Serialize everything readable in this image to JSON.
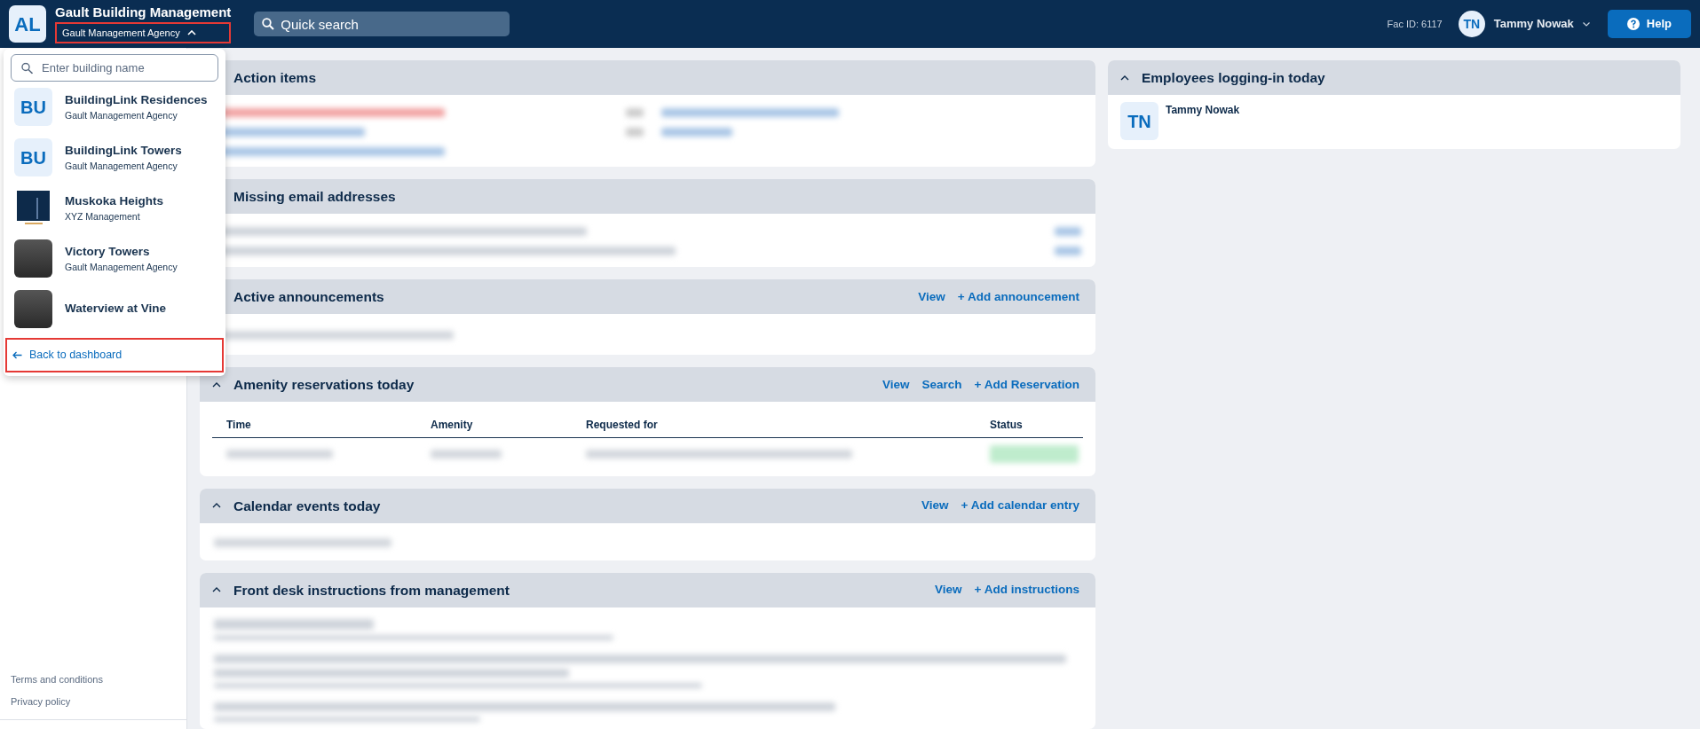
{
  "topbar": {
    "logo_initials": "AL",
    "company": "Gault Building Management",
    "agency_switcher": {
      "label": "Gault Management Agency",
      "expanded": true,
      "highlighted": true
    },
    "search": {
      "placeholder": "Quick search"
    },
    "fac_id": "Fac ID: 6117",
    "user": {
      "initials": "TN",
      "name": "Tammy Nowak"
    },
    "help": "Help"
  },
  "building_dropdown": {
    "search": {
      "placeholder": "Enter building name"
    },
    "buildings": [
      {
        "kind": "initials",
        "initials": "BU",
        "name": "BuildingLink Residences",
        "agency": "Gault Management Agency"
      },
      {
        "kind": "initials",
        "initials": "BU",
        "name": "BuildingLink Towers",
        "agency": "Gault Management Agency"
      },
      {
        "kind": "logo",
        "name": "Muskoka Heights",
        "agency": "XYZ Management"
      },
      {
        "kind": "photo",
        "name": "Victory Towers",
        "agency": "Gault Management Agency"
      },
      {
        "kind": "photo",
        "name": "Waterview at Vine"
      }
    ],
    "back_link": {
      "label": "Back to dashboard",
      "highlighted": true
    }
  },
  "sidebar_footer": [
    "Terms and conditions",
    "Privacy policy"
  ],
  "panels": [
    {
      "kind": "action_items",
      "title": "Action items"
    },
    {
      "kind": "missing_email",
      "title": "Missing email addresses"
    },
    {
      "kind": "announcements",
      "title": "Active announcements",
      "actions": [
        "View",
        "+ Add announcement"
      ]
    },
    {
      "kind": "table",
      "title": "Amenity reservations today",
      "actions": [
        "View",
        "Search",
        "+ Add Reservation"
      ],
      "columns": [
        "Time",
        "Amenity",
        "Requested for",
        "Status"
      ]
    },
    {
      "kind": "calendar",
      "title": "Calendar events today",
      "actions": [
        "View",
        "+ Add calendar entry"
      ]
    },
    {
      "kind": "instructions",
      "title": "Front desk instructions from management",
      "actions": [
        "View",
        "+ Add instructions"
      ]
    }
  ],
  "employees_panel": {
    "title": "Employees logging-in today",
    "employees": [
      {
        "initials": "TN",
        "name": "Tammy Nowak"
      }
    ]
  }
}
